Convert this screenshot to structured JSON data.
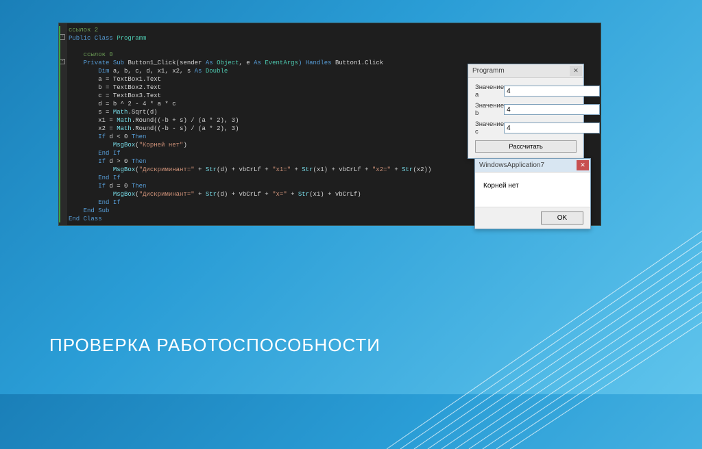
{
  "slide": {
    "title": "ПРОВЕРКА РАБОТОСПОСОБНОСТИ"
  },
  "code": {
    "refs2": "ссылок 2",
    "class_kw": "Public Class",
    "class_name": "Programm",
    "refs0": "ссылок 0",
    "sub_kw": "Private Sub",
    "sub_name": "Button1_Click(sender",
    "as_kw": "As",
    "obj_t": "Object",
    "arg_e": ", e",
    "evargs_t": "EventArgs",
    "handles_kw": ") Handles",
    "handles_t": "Button1.Click",
    "dim_kw": "Dim",
    "dim_vars": "a, b, c, d, x1, x2, s",
    "double_t": "Double",
    "l_a": "a = TextBox1.Text",
    "l_b": "b = TextBox2.Text",
    "l_c": "c = TextBox3.Text",
    "l_d": "d = b ^ 2 - 4 * a * c",
    "l_s_pre": "s = ",
    "math": "Math",
    "sqrt": ".Sqrt(d)",
    "l_x1_pre": "x1 = ",
    "round1": ".Round((-b + s) / (a * 2), 3)",
    "l_x2_pre": "x2 = ",
    "round2": ".Round((-b - s) / (a * 2), 3)",
    "if_kw": "If",
    "then_kw": "Then",
    "cond1": "d < 0",
    "msg_kw": "MsgBox",
    "msg1": "\"Корней нет\"",
    "endif_kw": "End If",
    "cond2": "d > 0",
    "msg2a": "\"Дискриминант=\"",
    "plus": " + ",
    "str_kw": "Str",
    "strd": "(d)",
    "vbcrlf": "vbCrLf",
    "sx1": "\"x1=\"",
    "strx1": "(x1)",
    "sx2": "\"x2=\"",
    "strx2": "(x2)",
    "cond3": "d = 0",
    "sx": "\"x=\"",
    "endsub_kw": "End Sub",
    "endclass_kw": "End Class"
  },
  "form": {
    "title": "Programm",
    "label_a": "Значение a",
    "label_b": "Значение b",
    "label_c": "Значение c",
    "val_a": "4",
    "val_b": "4",
    "val_c": "4",
    "btn": "Рассчитать"
  },
  "msgbox": {
    "title": "WindowsApplication7",
    "body": "Корней нет",
    "ok": "OK"
  }
}
